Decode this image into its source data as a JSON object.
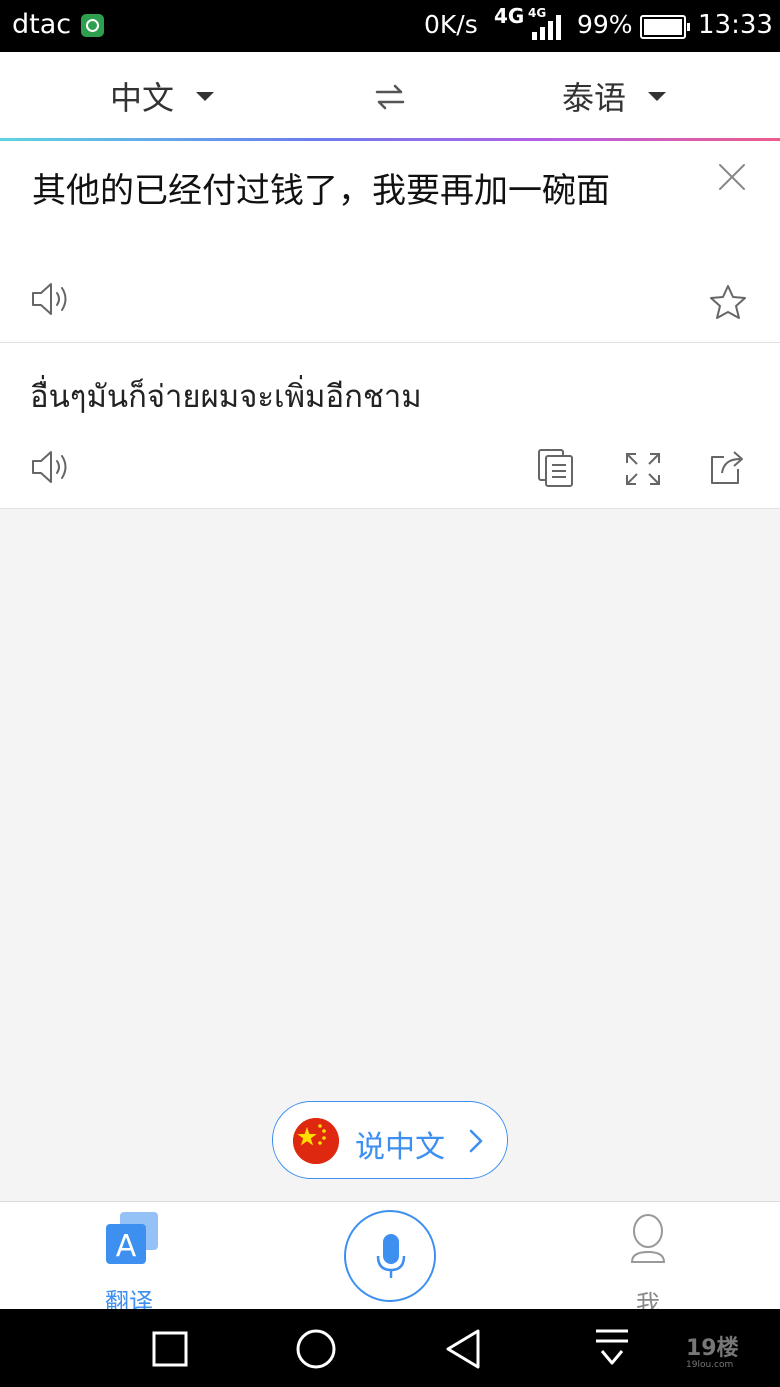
{
  "status_bar": {
    "carrier": "dtac",
    "net_speed": "0K/s",
    "network_type": "4G",
    "network_type_small": "4G",
    "battery": "99%",
    "time": "13:33"
  },
  "language_bar": {
    "source_language": "中文",
    "target_language": "泰语"
  },
  "source": {
    "text": "其他的已经付过钱了，我要再加一碗面"
  },
  "result": {
    "text": "อื่นๆมันก็จ่ายผมจะเพิ่มอีกชาม"
  },
  "speak_button": {
    "label": "说中文"
  },
  "tab_bar": {
    "translate_icon_letter": "A",
    "translate_label": "翻译",
    "me_label": "我"
  },
  "watermark": {
    "text": "19楼",
    "subtext": "19lou.com"
  },
  "colors": {
    "accent": "#3d8ff0",
    "flag_red": "#de2910",
    "flag_star": "#ffde00"
  }
}
